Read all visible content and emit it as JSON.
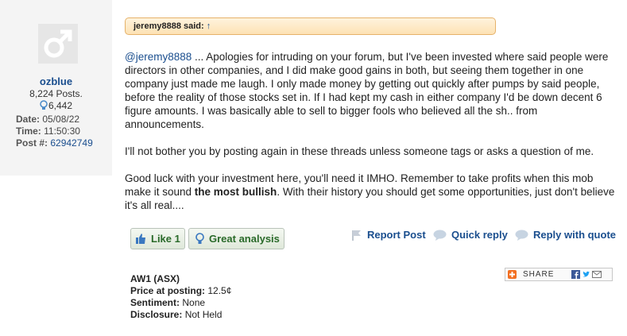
{
  "user": {
    "name": "ozblue",
    "posts": "8,224 Posts.",
    "likes": "6,442",
    "date_label": "Date:",
    "date": "05/08/22",
    "time_label": "Time:",
    "time": "11:50:30",
    "postnum_label": "Post #:",
    "postnum": "62942749"
  },
  "quote": {
    "text": "jeremy8888 said:",
    "arrow": "↑"
  },
  "post": {
    "mention": "@jeremy8888",
    "p1": " ... Apologies for intruding on your forum, but I've been invested where said people were directors in other companies, and I did make good gains in both, but seeing them together in one company just made me laugh. I only made money by getting out quickly after pumps by said people, before the reality of those stocks set in. If I had kept my cash in either company I'd be down decent 6 figure amounts. I was basically able to sell to bigger fools who believed all the sh.. from announcements.",
    "p2": "I'll not bother you by posting again in these threads unless someone tags or asks a question of me.",
    "p3a": "Good luck with your investment here, you'll need it IMHO. Remember to take profits when this mob make it sound ",
    "p3b": "the most bullish",
    "p3c": ". With their history you should get some opportunities, just don't believe it's all real...."
  },
  "buttons": {
    "like": "Like 1",
    "great": "Great analysis"
  },
  "actions": {
    "report": "Report Post",
    "quick": "Quick reply",
    "quote": "Reply with quote"
  },
  "stock": {
    "code": "AW1 (ASX)",
    "price_label": "Price at posting:",
    "price": "12.5¢",
    "sentiment_label": "Sentiment:",
    "sentiment": "None",
    "disclosure_label": "Disclosure:",
    "disclosure": "Not Held"
  },
  "share": {
    "label": "SHARE"
  },
  "colors": {
    "link": "#1a4e8e",
    "button_text": "#2a6a2a",
    "sidebar_bg": "#f4f4f4",
    "quote_border": "#e6b26a"
  }
}
